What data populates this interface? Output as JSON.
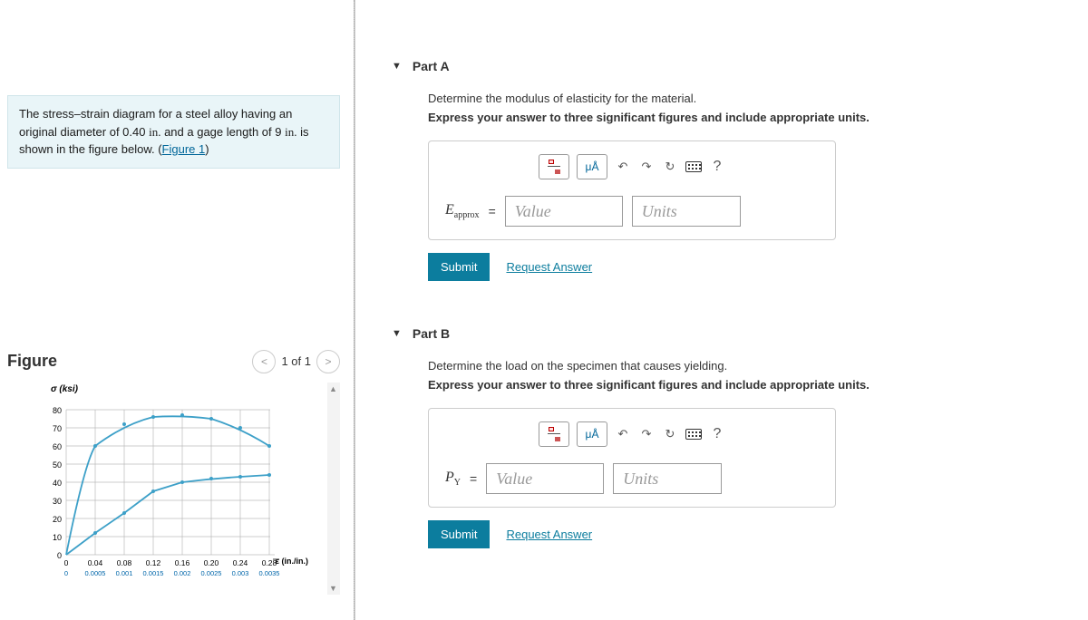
{
  "problem": {
    "text_1": "The stress–strain diagram for a steel alloy having an original diameter of 0.40 ",
    "unit_1": "in.",
    "text_2": " and a gage length of 9 ",
    "unit_2": "in.",
    "text_3": " is shown in the figure below. (",
    "link": "Figure 1",
    "text_4": ")"
  },
  "figure": {
    "title": "Figure",
    "count": "1 of 1"
  },
  "chart_data": {
    "type": "line",
    "ylabel": "σ (ksi)",
    "xlabel": "ε (in./in.)",
    "y_ticks": [
      0,
      10,
      20,
      30,
      40,
      50,
      60,
      70,
      80
    ],
    "ylim": [
      0,
      80
    ],
    "x_ticks_outer": [
      0,
      0.04,
      0.08,
      0.12,
      0.16,
      0.2,
      0.24,
      0.28
    ],
    "x_ticks_inner": [
      0,
      0.0005,
      0.001,
      0.0015,
      0.002,
      0.0025,
      0.003,
      0.0035
    ],
    "series": [
      {
        "name": "outer-scale-curve",
        "x": [
          0,
          0.04,
          0.08,
          0.12,
          0.16,
          0.2,
          0.24,
          0.28
        ],
        "y": [
          0,
          60,
          72,
          76,
          77,
          75,
          70,
          60
        ]
      },
      {
        "name": "inner-scale-curve",
        "x": [
          0,
          0.0005,
          0.001,
          0.0015,
          0.002,
          0.0025,
          0.003,
          0.0035
        ],
        "y": [
          0,
          12,
          23,
          35,
          40,
          42,
          43,
          44
        ]
      }
    ]
  },
  "partA": {
    "label": "Part A",
    "prompt": "Determine the modulus of elasticity for the material.",
    "instruction": "Express your answer to three significant figures and include appropriate units.",
    "var_base": "E",
    "var_sub": "approx",
    "value_ph": "Value",
    "units_ph": "Units",
    "mu_label": "μÅ",
    "help": "?"
  },
  "partB": {
    "label": "Part B",
    "prompt": "Determine the load on the specimen that causes yielding.",
    "instruction": "Express your answer to three significant figures and include appropriate units.",
    "var_base": "P",
    "var_sub": "Y",
    "value_ph": "Value",
    "units_ph": "Units",
    "mu_label": "μÅ",
    "help": "?"
  },
  "actions": {
    "submit": "Submit",
    "request": "Request Answer"
  }
}
